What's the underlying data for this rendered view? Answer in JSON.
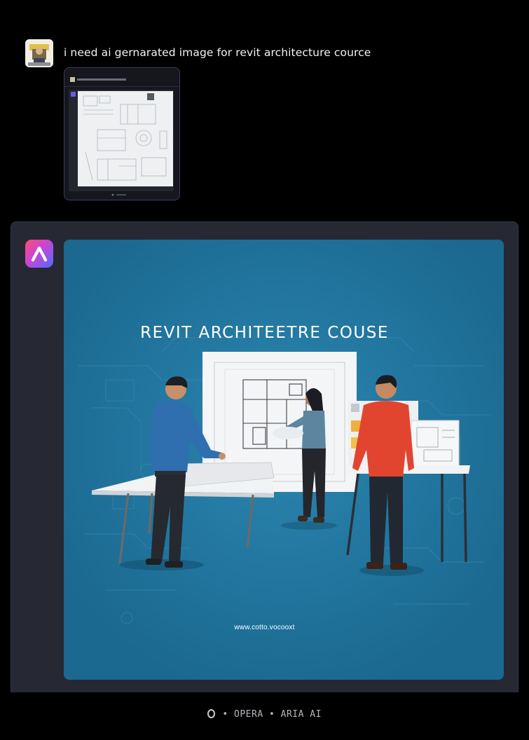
{
  "conversation": {
    "user_message": "i need ai gernarated image for revit architecture cource",
    "user_avatar_icon": "user-avatar",
    "assistant_logo_icon": "aria-logo-icon"
  },
  "generated_image": {
    "title": "REVIT ARCHITEETRE COUSE",
    "url_text": "www.cotto.vocooxt",
    "background_color": "#1e6b92"
  },
  "footer": {
    "brand": "OPERA",
    "product": "ARIA AI",
    "separator": "•"
  }
}
